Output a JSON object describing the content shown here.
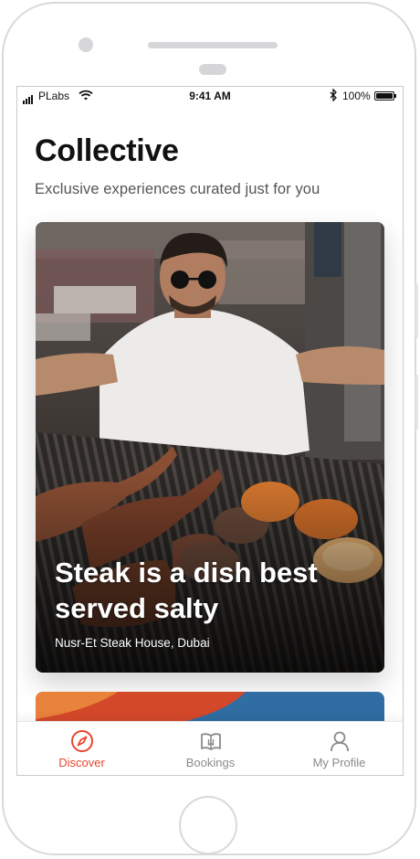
{
  "status_bar": {
    "carrier": "PLabs",
    "time": "9:41 AM",
    "battery": "100%",
    "bluetooth_icon": "bluetooth-icon",
    "wifi_icon": "wifi-icon"
  },
  "header": {
    "title": "Collective",
    "subtitle": "Exclusive experiences curated just for you"
  },
  "featured_card": {
    "title": "Steak is a dish best served salty",
    "location": "Nusr-Et Steak House, Dubai"
  },
  "tabbar": {
    "items": [
      {
        "label": "Discover",
        "icon": "compass-icon",
        "active": true
      },
      {
        "label": "Bookings",
        "icon": "book-icon",
        "active": false
      },
      {
        "label": "My Profile",
        "icon": "person-icon",
        "active": false
      }
    ]
  },
  "colors": {
    "accent": "#e8452f",
    "inactive": "#8a8a8e",
    "title": "#111111",
    "subtitle": "#555555"
  }
}
